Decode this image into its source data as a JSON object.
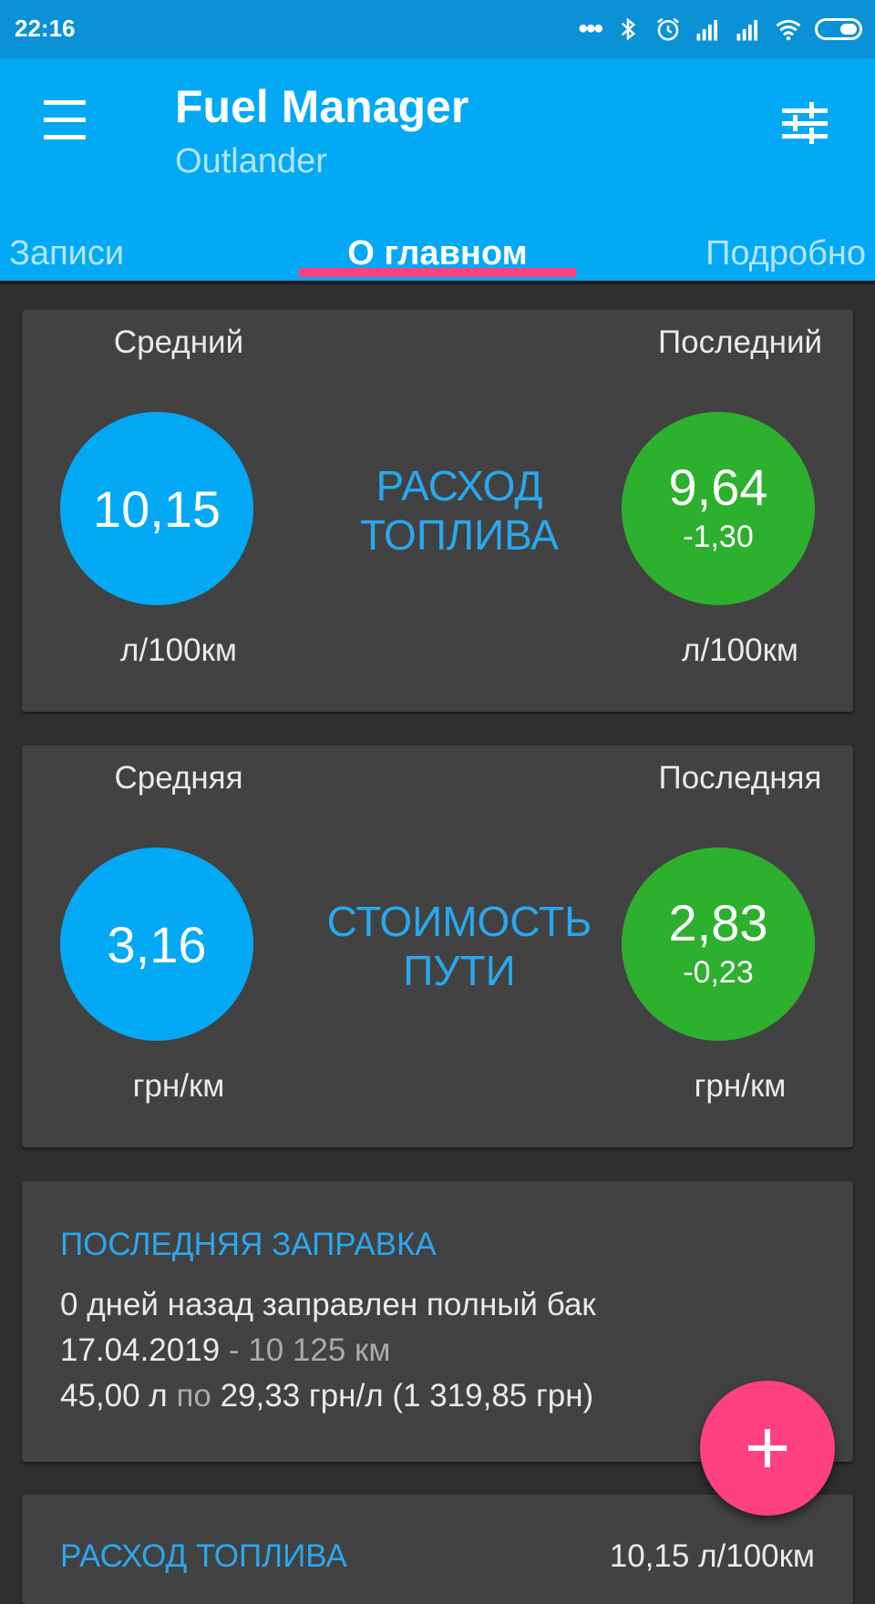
{
  "status_bar": {
    "time": "22:16",
    "icons": [
      "dots-icon",
      "bluetooth-icon",
      "alarm-icon",
      "signal-icon",
      "signal-icon",
      "wifi-icon",
      "battery-icon"
    ]
  },
  "app_bar": {
    "title": "Fuel Manager",
    "subtitle": "Outlander",
    "menu_icon": "hamburger-menu-icon",
    "filter_icon": "sliders-icon",
    "tabs": [
      {
        "label": "Записи"
      },
      {
        "label": "О главном",
        "selected": true
      },
      {
        "label": "Подробно"
      }
    ]
  },
  "consumption": {
    "title_line1": "РАСХОД",
    "title_line2": "ТОПЛИВА",
    "avg_label": "Средний",
    "avg_value": "10,15",
    "avg_unit": "л/100км",
    "last_label": "Последний",
    "last_value": "9,64",
    "last_delta": "-1,30",
    "last_unit": "л/100км"
  },
  "trip_cost": {
    "title_line1": "СТОИМОСТЬ",
    "title_line2": "ПУТИ",
    "avg_label": "Средняя",
    "avg_value": "3,16",
    "avg_unit": "грн/км",
    "last_label": "Последняя",
    "last_value": "2,83",
    "last_delta": "-0,23",
    "last_unit": "грн/км"
  },
  "last_refuel": {
    "title": "ПОСЛЕДНЯЯ ЗАПРАВКА",
    "line1": "0 дней назад заправлен полный бак",
    "date": "17.04.2019",
    "date_sep": " - ",
    "odometer": "10 125 км",
    "volume": "45,00 л",
    "by": " по ",
    "price": "29,33 грн/л (1 319,85 грн)"
  },
  "next_card": {
    "title": "РАСХОД ТОПЛИВА",
    "value": "10,15 л/100км"
  },
  "fab": {
    "icon": "plus-icon"
  },
  "colors": {
    "primary": "#03a9f4",
    "status_bar": "#0b92d6",
    "accent": "#ff4081",
    "green": "#2db02d",
    "card": "#424242",
    "background": "#2f2f2f"
  }
}
